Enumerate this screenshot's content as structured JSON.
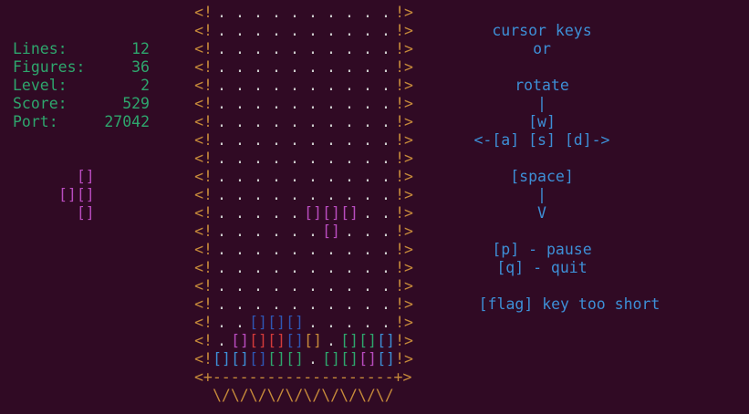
{
  "stats": {
    "lines_label": "Lines:",
    "lines": "12",
    "figures_label": "Figures:",
    "figures": "36",
    "level_label": "Level:",
    "level": "2",
    "score_label": "Score:",
    "score": "529",
    "port_label": "Port:",
    "port": "27042"
  },
  "next_piece": [
    "  []",
    "[][]",
    "  []"
  ],
  "well": {
    "left_wall": "<!",
    "right_wall": "!>",
    "empty_cell": ".",
    "block": "[]",
    "floor": "<+--------------------+>",
    "base": "\\/\\/\\/\\/\\/\\/\\/\\/\\/\\/",
    "rows": [
      "..........",
      "..........",
      "..........",
      "..........",
      "..........",
      "..........",
      "..........",
      "..........",
      "..........",
      "..........",
      "..........",
      ".....PPP..",
      "......P...",
      "..........",
      "..........",
      "..........",
      "..........",
      "..BBB.....",
      ".MRRBO.GGC",
      "CCBGG.GGMC"
    ],
    "colors": {
      "P": "#b84cbe",
      "B": "#2e56b3",
      "M": "#b84cbe",
      "R": "#d23a3a",
      "O": "#c68a3a",
      "G": "#2ea66d",
      "C": "#3d8fd6"
    }
  },
  "help": {
    "line1": "cursor keys",
    "line2": "or",
    "line3": "rotate",
    "line4": "|",
    "line5": "[w]",
    "line6": "<-[a] [s] [d]->",
    "line7": "[space]",
    "line8": "|",
    "line9": "V",
    "line10": "[p] - pause",
    "line11": "[q] - quit",
    "line12": "[flag] key too short"
  }
}
